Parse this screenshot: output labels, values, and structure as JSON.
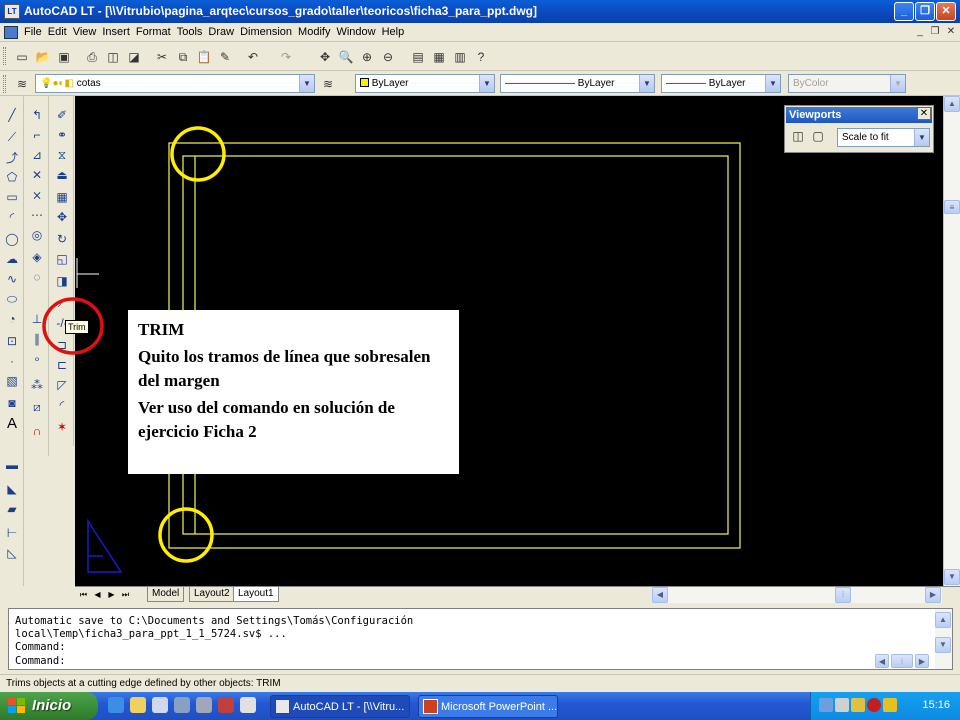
{
  "window": {
    "title": "AutoCAD LT - [\\\\Vitrubio\\pagina_arqtec\\cursos_grado\\taller\\teoricos\\ficha3_para_ppt.dwg]",
    "app_badge": "LT",
    "minimize": "_",
    "maximize": "❐",
    "close": "✕"
  },
  "menubar": {
    "items": [
      "File",
      "Edit",
      "View",
      "Insert",
      "Format",
      "Tools",
      "Draw",
      "Dimension",
      "Modify",
      "Window",
      "Help"
    ]
  },
  "layers_toolbar": {
    "layer_value": "cotas"
  },
  "properties_toolbar": {
    "color": "ByLayer",
    "linetype": "ByLayer",
    "lineweight": "ByLayer",
    "plotstyle": "ByColor"
  },
  "viewports_panel": {
    "title": "Viewports",
    "scale_value": "Scale to fit"
  },
  "tooltip": {
    "text": "Trim"
  },
  "callout": {
    "heading": "TRIM",
    "line1": "Quito los tramos de línea que sobresalen del margen",
    "line2": "Ver uso del comando en solución de ejercicio Ficha 2"
  },
  "layout_tabs": {
    "tabs": [
      "Model",
      "Layout2",
      "Layout1"
    ],
    "active": "Layout1"
  },
  "command_window": {
    "lines": [
      "Automatic save to C:\\Documents and Settings\\Tomás\\Configuración",
      "local\\Temp\\ficha3_para_ppt_1_1_5724.sv$ ...",
      "Command:",
      "Command:"
    ]
  },
  "statusbar": {
    "text": "Trims objects at a cutting edge defined by other objects:  TRIM"
  },
  "taskbar": {
    "start_label": "Inicio",
    "tasks": [
      "AutoCAD LT - [\\\\Vitru...",
      "Microsoft PowerPoint ..."
    ],
    "clock": "15:16"
  },
  "colors": {
    "drawing_bg": "#000000",
    "drawing_lines": "#e6e64a",
    "highlight_yellow": "#ffee00",
    "highlight_red": "#e01010",
    "ucs_icon": "#1a1acc"
  }
}
